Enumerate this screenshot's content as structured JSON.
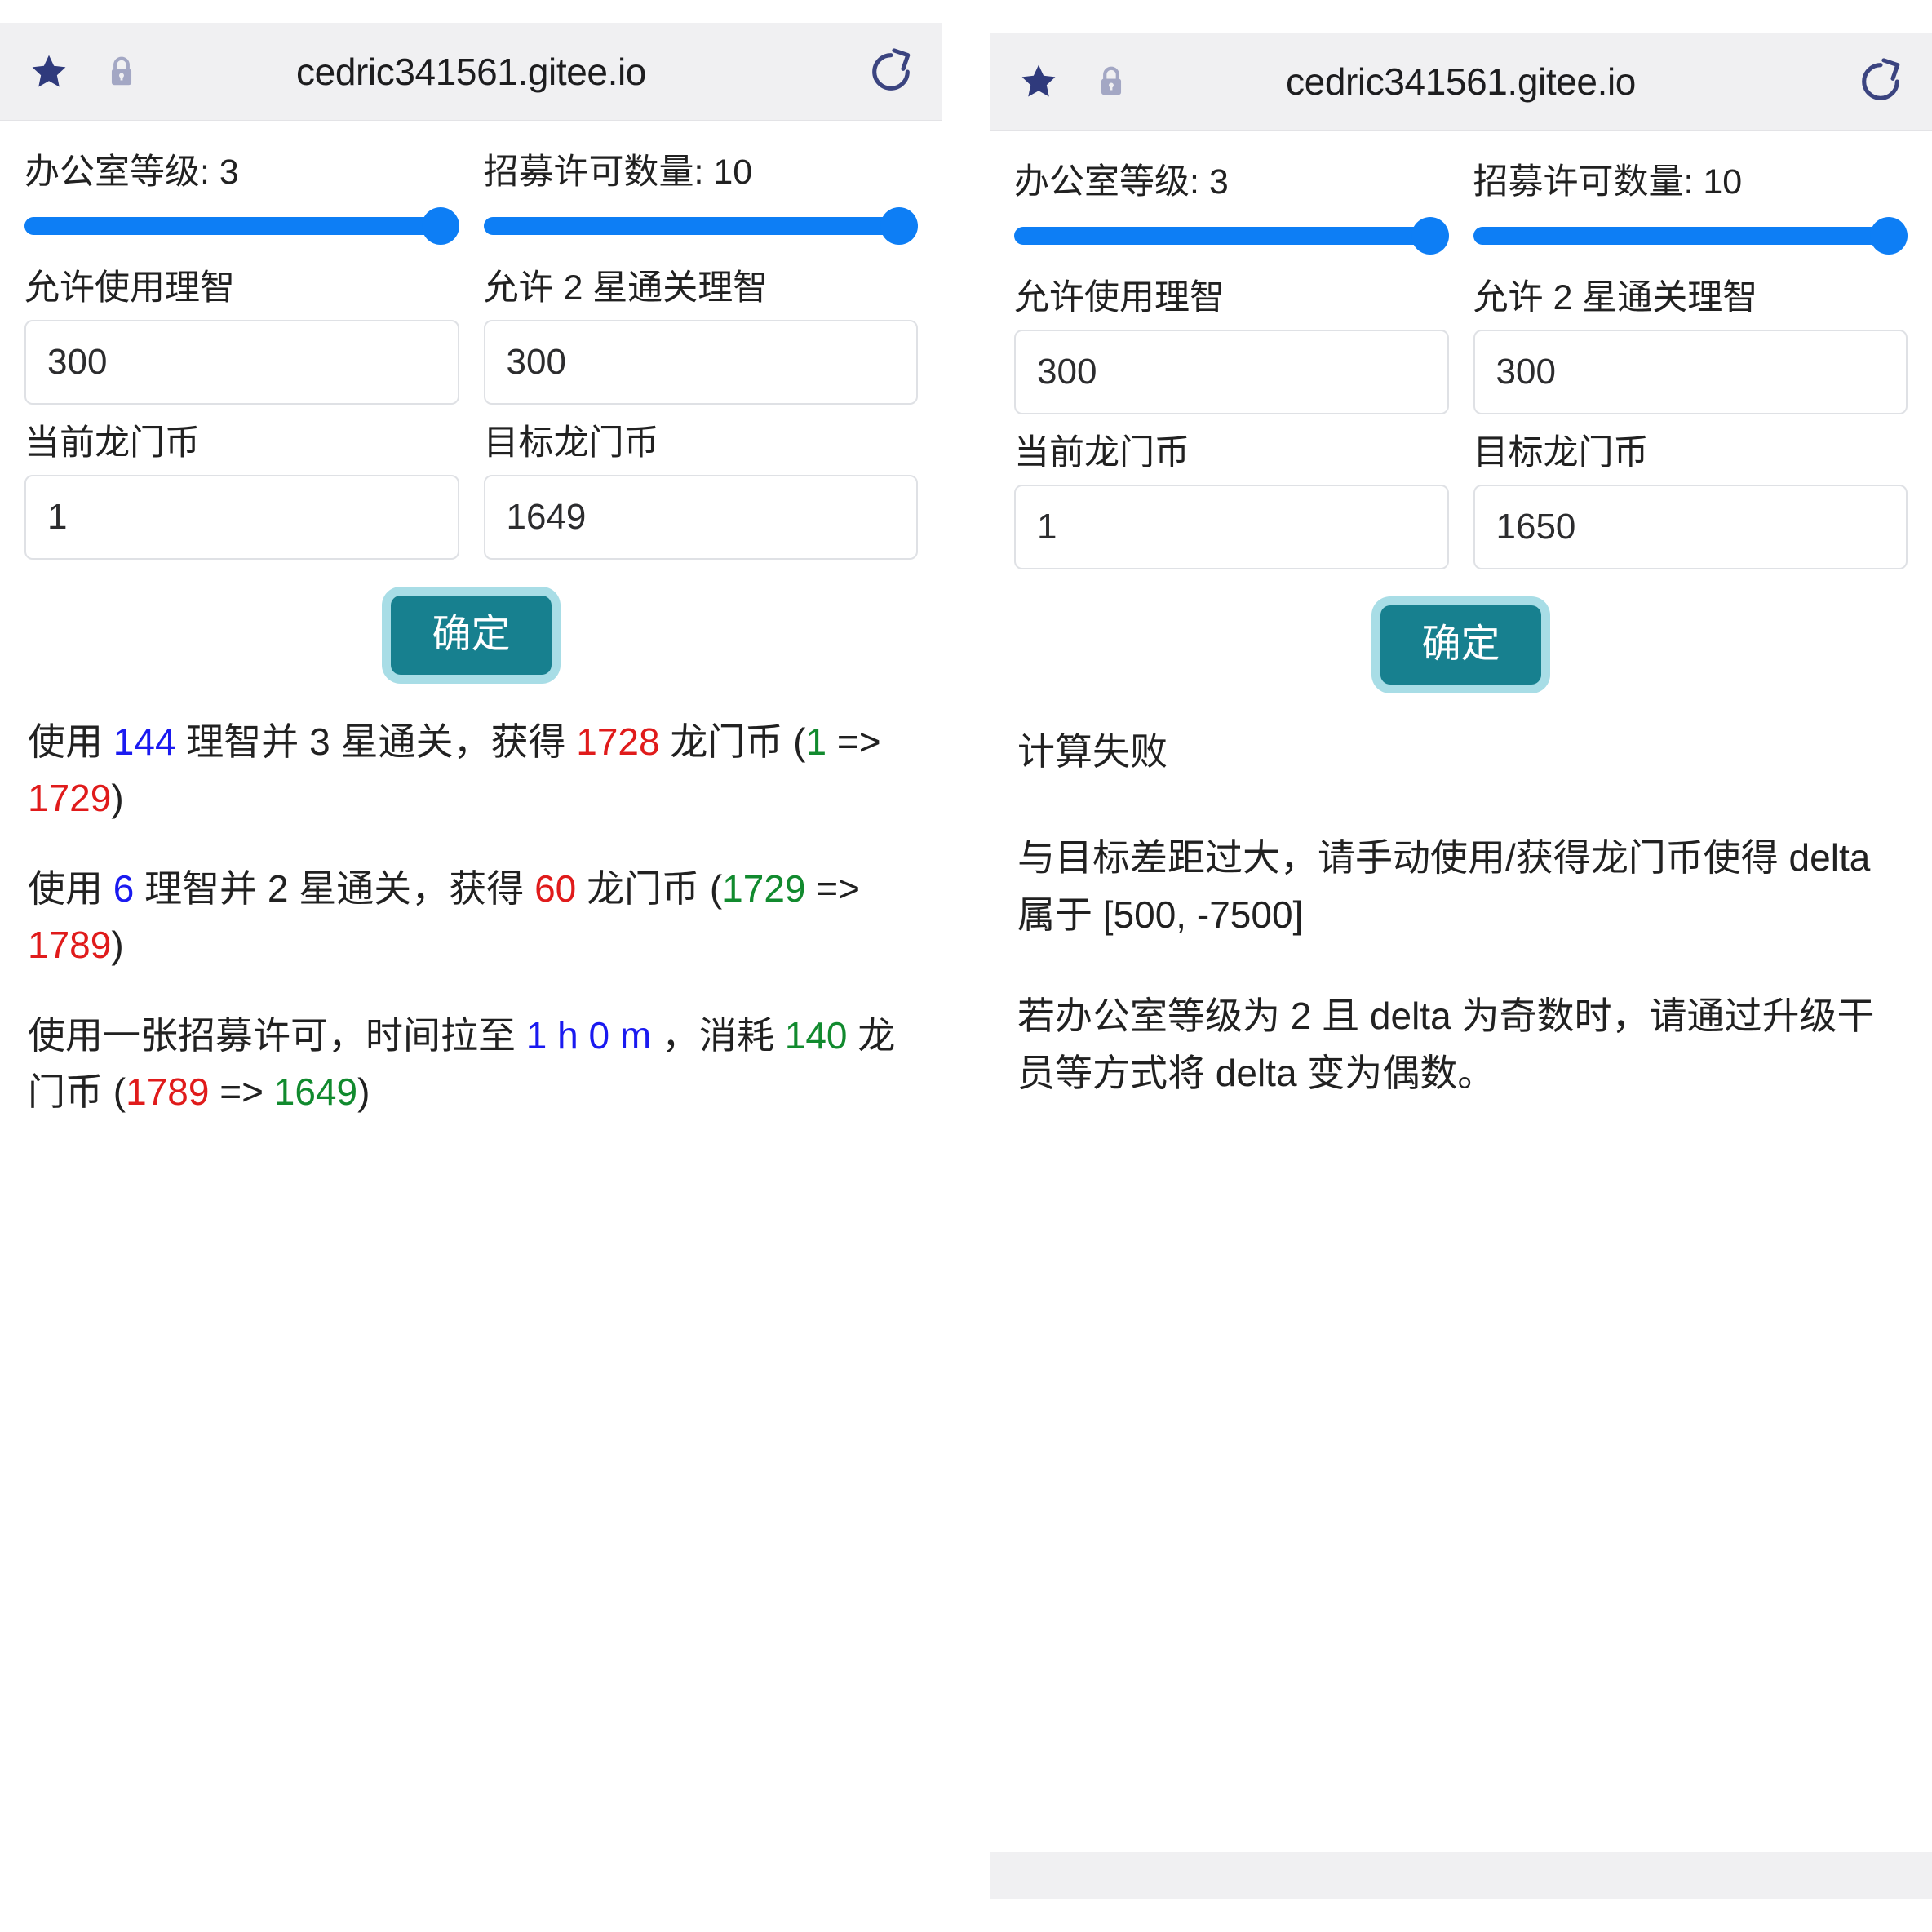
{
  "browser": {
    "url": "cedric341561.gitee.io",
    "star_icon": "star-icon",
    "lock_icon": "lock-icon",
    "refresh_icon": "refresh-icon"
  },
  "colors": {
    "slider": "#0d7ef5",
    "button": "#17808f",
    "button_ring": "#a8dde6",
    "blue_number": "#1a1af0",
    "red_number": "#e01b1b",
    "green_number": "#118a2e"
  },
  "left": {
    "office_level": {
      "label": "办公室等级: 3"
    },
    "recruit_permits": {
      "label": "招募许可数量: 10"
    },
    "sanity_label": "允许使用理智",
    "sanity_value": "300",
    "two_star_label": "允许 2 星通关理智",
    "two_star_value": "300",
    "current_lmb_label": "当前龙门币",
    "current_lmb_value": "1",
    "target_lmb_label": "目标龙门币",
    "target_lmb_value": "1649",
    "submit_label": "确定",
    "results": [
      {
        "parts": [
          {
            "t": "使用 ",
            "c": "dark"
          },
          {
            "t": "144",
            "c": "blue"
          },
          {
            "t": " 理智并 3 星通关，获得 ",
            "c": "dark"
          },
          {
            "t": "1728",
            "c": "red"
          },
          {
            "t": " 龙门币 (",
            "c": "dark"
          },
          {
            "t": "1",
            "c": "green"
          },
          {
            "t": " => ",
            "c": "dark"
          },
          {
            "t": "1729",
            "c": "red"
          },
          {
            "t": ")",
            "c": "dark"
          }
        ]
      },
      {
        "parts": [
          {
            "t": "使用 ",
            "c": "dark"
          },
          {
            "t": "6",
            "c": "blue"
          },
          {
            "t": " 理智并 2 星通关，获得 ",
            "c": "dark"
          },
          {
            "t": "60",
            "c": "red"
          },
          {
            "t": " 龙门币 (",
            "c": "dark"
          },
          {
            "t": "1729",
            "c": "green"
          },
          {
            "t": " => ",
            "c": "dark"
          },
          {
            "t": "1789",
            "c": "red"
          },
          {
            "t": ")",
            "c": "dark"
          }
        ]
      },
      {
        "parts": [
          {
            "t": "使用一张招募许可，时间拉至 ",
            "c": "dark"
          },
          {
            "t": "1 h 0 m",
            "c": "blue"
          },
          {
            "t": " ，消耗 ",
            "c": "dark"
          },
          {
            "t": "140",
            "c": "green"
          },
          {
            "t": " 龙门币 (",
            "c": "dark"
          },
          {
            "t": "1789",
            "c": "red"
          },
          {
            "t": " => ",
            "c": "dark"
          },
          {
            "t": "1649",
            "c": "green"
          },
          {
            "t": ")",
            "c": "dark"
          }
        ]
      }
    ]
  },
  "right": {
    "office_level": {
      "label": "办公室等级: 3"
    },
    "recruit_permits": {
      "label": "招募许可数量: 10"
    },
    "sanity_label": "允许使用理智",
    "sanity_value": "300",
    "two_star_label": "允许 2 星通关理智",
    "two_star_value": "300",
    "current_lmb_label": "当前龙门币",
    "current_lmb_value": "1",
    "target_lmb_label": "目标龙门币",
    "target_lmb_value": "1650",
    "submit_label": "确定",
    "error_title": "计算失败",
    "error_body_1": "与目标差距过大，请手动使用/获得龙门币使得 delta 属于 [500, -7500]",
    "error_body_2": "若办公室等级为 2 且 delta 为奇数时，请通过升级干员等方式将 delta 变为偶数。"
  }
}
